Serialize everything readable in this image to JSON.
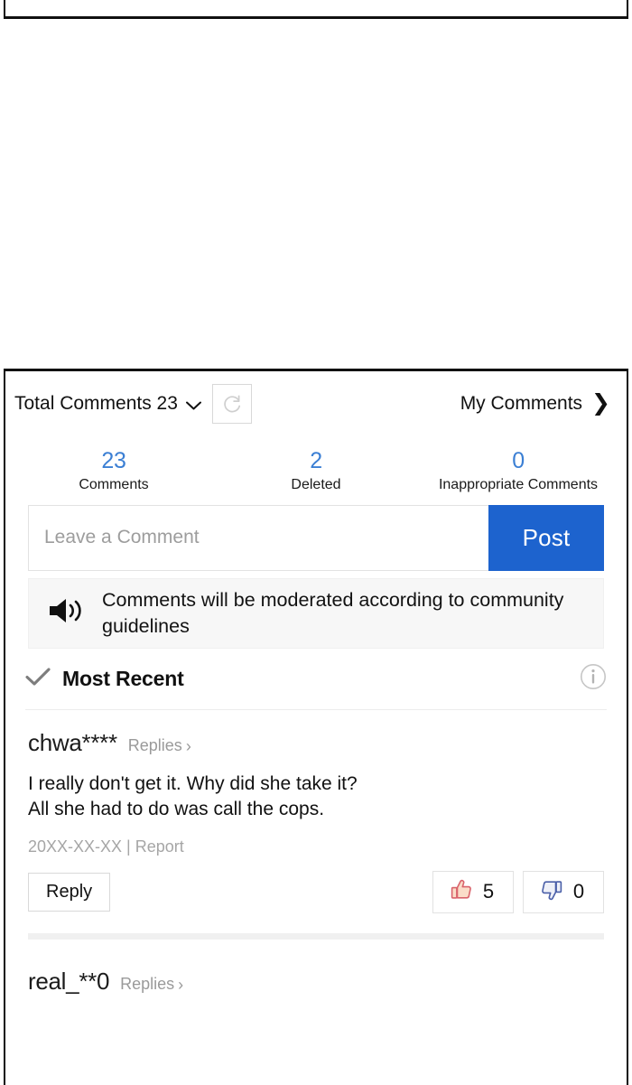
{
  "header": {
    "total_comments_label": "Total Comments 23",
    "chevron_icon": "chevron-down-icon",
    "refresh_icon": "refresh-icon",
    "my_comments_label": "My Comments",
    "my_comments_chevron": "❯"
  },
  "stats": [
    {
      "value": "23",
      "label": "Comments"
    },
    {
      "value": "2",
      "label": "Deleted"
    },
    {
      "value": "0",
      "label": "Inappropriate\nComments"
    }
  ],
  "composer": {
    "placeholder": "Leave a Comment",
    "value": "",
    "post_label": "Post"
  },
  "notice": {
    "icon": "speaker-icon",
    "text": "Comments will be moderated according to community guidelines"
  },
  "sort": {
    "check_icon": "check-icon",
    "label": "Most Recent",
    "info_icon": "info-icon"
  },
  "comments": [
    {
      "author": "chwa****",
      "replies_label": "Replies",
      "replies_chevron": "›",
      "body": "I really don't get it. Why did she take it?\nAll she had to do was call the cops.",
      "date": "20XX-XX-XX",
      "meta_separator": " | ",
      "report_label": "Report",
      "reply_label": "Reply",
      "like_count": "5",
      "dislike_count": "0",
      "like_icon": "thumbs-up-icon",
      "dislike_icon": "thumbs-down-icon"
    },
    {
      "author": "real_**0",
      "replies_label": "Replies",
      "replies_chevron": "›"
    }
  ],
  "colors": {
    "accent_blue": "#3b7fd4",
    "post_button_blue": "#1d63ce",
    "muted_gray": "#9a9a9a",
    "notice_bg": "#f7f7f7",
    "separator_gray": "#f0f0f0",
    "thumbs_up": "#d9636b",
    "thumbs_down": "#4a5fa8"
  }
}
